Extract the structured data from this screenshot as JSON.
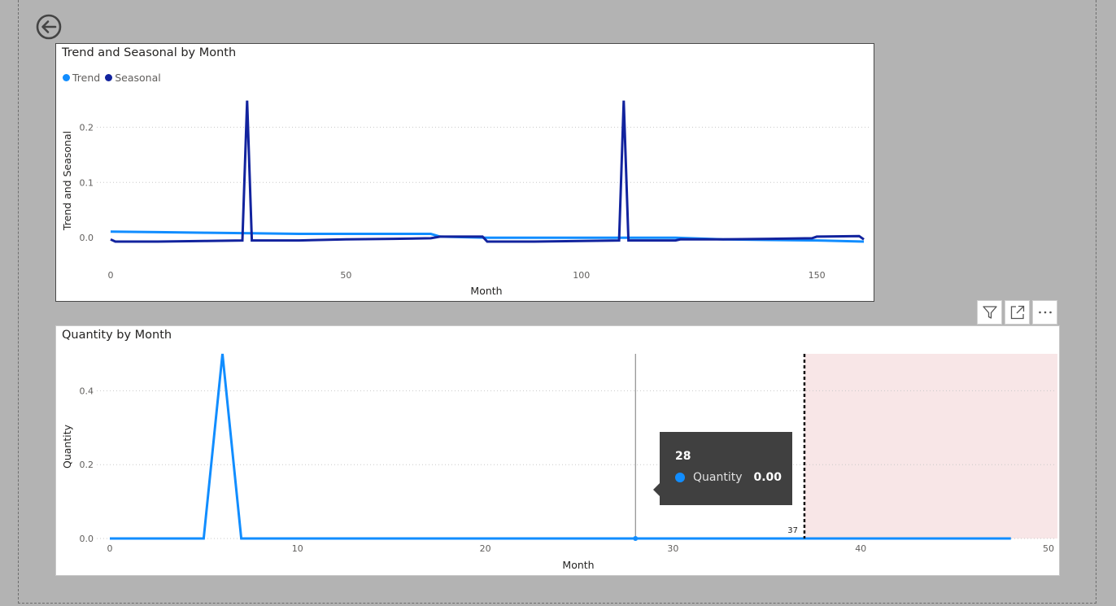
{
  "nav": {
    "back_icon": "circle-arrow-left-icon"
  },
  "visual_header": {
    "icons": [
      "filter-icon",
      "focus-mode-icon",
      "more-options-icon"
    ]
  },
  "colors": {
    "trend": "#118dff",
    "seasonal": "#12239e",
    "quantity": "#118dff",
    "forecast_band": "#f8e6e7"
  },
  "chart_data": [
    {
      "type": "line",
      "title": "Trend and Seasonal by Month",
      "xlabel": "Month",
      "ylabel": "Trend and Seasonal",
      "xlim": [
        0,
        160
      ],
      "ylim": [
        -0.06,
        0.28
      ],
      "xticks": [
        0,
        50,
        100,
        150
      ],
      "yticks": [
        0.0,
        0.1,
        0.2
      ],
      "ytick_labels": [
        "0.0",
        "0.1",
        "0.2"
      ],
      "grid": true,
      "legend": "top-left",
      "series": [
        {
          "name": "Trend",
          "x": [
            0,
            10,
            20,
            30,
            40,
            50,
            60,
            68,
            70,
            80,
            90,
            100,
            110,
            120,
            130,
            140,
            150,
            160
          ],
          "y": [
            0.011,
            0.01,
            0.009,
            0.008,
            0.007,
            0.007,
            0.007,
            0.007,
            0.002,
            0.0,
            0.0,
            0.0,
            0.0,
            0.0,
            -0.003,
            -0.004,
            -0.005,
            -0.007
          ]
        },
        {
          "name": "Seasonal",
          "x": [
            0,
            1,
            10,
            20,
            28,
            29,
            30,
            40,
            50,
            60,
            68,
            70,
            79,
            80,
            81,
            90,
            100,
            108,
            109,
            110,
            120,
            121,
            130,
            140,
            149,
            150,
            159,
            160
          ],
          "y": [
            -0.003,
            -0.007,
            -0.007,
            -0.006,
            -0.005,
            0.248,
            -0.005,
            -0.005,
            -0.003,
            -0.002,
            -0.001,
            0.002,
            0.002,
            -0.007,
            -0.007,
            -0.007,
            -0.006,
            -0.005,
            0.248,
            -0.005,
            -0.005,
            -0.003,
            -0.003,
            -0.002,
            -0.001,
            0.002,
            0.003,
            -0.003
          ]
        }
      ]
    },
    {
      "type": "line",
      "title": "Quantity by Month",
      "xlabel": "Month",
      "ylabel": "Quantity",
      "xlim": [
        0,
        50
      ],
      "ylim": [
        0,
        0.5
      ],
      "xticks": [
        0,
        10,
        20,
        30,
        40,
        50
      ],
      "yticks": [
        0.0,
        0.2,
        0.4
      ],
      "ytick_labels": [
        "0.0",
        "0.2",
        "0.4"
      ],
      "grid": true,
      "series": [
        {
          "name": "Quantity",
          "x": [
            0,
            5,
            6,
            7,
            10,
            20,
            28,
            30,
            37,
            40,
            48
          ],
          "y": [
            0,
            0,
            0.5,
            0,
            0,
            0,
            0,
            0,
            0,
            0,
            0
          ]
        }
      ],
      "forecast_start": 37,
      "forecast_label": "37",
      "hover": {
        "x": 28,
        "label": "28",
        "series": "Quantity",
        "value": "0.00"
      }
    }
  ]
}
